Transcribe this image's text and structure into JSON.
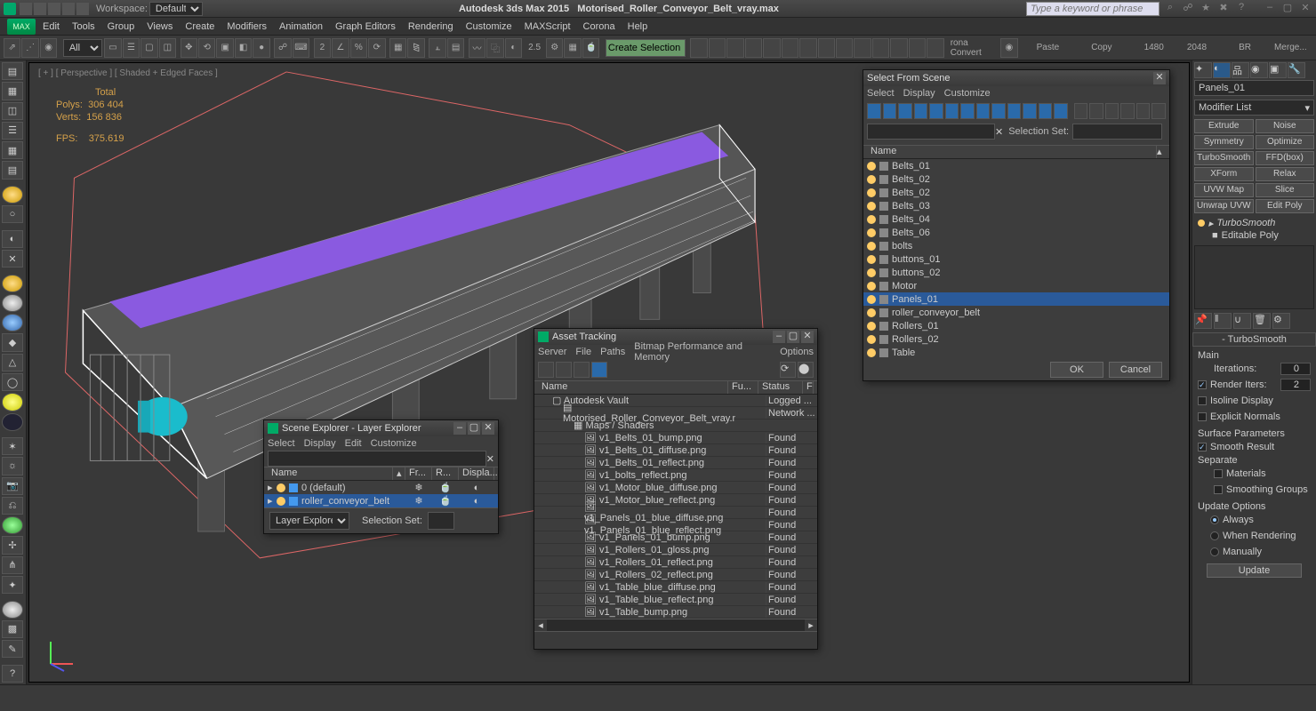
{
  "titlebar": {
    "workspace_label": "Workspace:",
    "workspace_value": "Default",
    "app": "Autodesk 3ds Max  2015",
    "file": "Motorised_Roller_Conveyor_Belt_vray.max",
    "search_placeholder": "Type a keyword or phrase"
  },
  "menu": [
    "Edit",
    "Tools",
    "Group",
    "Views",
    "Create",
    "Modifiers",
    "Animation",
    "Graph Editors",
    "Rendering",
    "Customize",
    "MAXScript",
    "Corona",
    "Help"
  ],
  "toolbar": {
    "filter_all": "All",
    "angle_snap": "2.5",
    "sel_filter": "Create Selection Se",
    "corona_convert": "rona Convert",
    "cmd_paste": "Paste",
    "cmd_copy": "Copy",
    "num1": "1480",
    "num2": "2048",
    "br": "BR",
    "merge": "Merge..."
  },
  "viewport": {
    "label": "[ + ] [ Perspective ] [ Shaded + Edged Faces ]",
    "stats": {
      "total": "Total",
      "polys_l": "Polys:",
      "polys": "306 404",
      "verts_l": "Verts:",
      "verts": "156 836",
      "fps_l": "FPS:",
      "fps": "375.619"
    }
  },
  "right": {
    "object_name": "Panels_01",
    "modifier_list": "Modifier List",
    "mod_buttons": [
      "Extrude",
      "Noise",
      "Symmetry",
      "Optimize",
      "TurboSmooth",
      "FFD(box)",
      "XForm",
      "Relax",
      "UVW Map",
      "Slice",
      "Unwrap UVW",
      "Edit Poly"
    ],
    "stack": [
      "TurboSmooth",
      "Editable Poly"
    ],
    "rollout_title": "TurboSmooth",
    "main": "Main",
    "iterations_l": "Iterations:",
    "iterations": "0",
    "render_iters_l": "Render Iters:",
    "render_iters": "2",
    "isoline": "Isoline Display",
    "explicit": "Explicit Normals",
    "surf_params": "Surface Parameters",
    "smooth_result": "Smooth Result",
    "separate": "Separate",
    "materials": "Materials",
    "smoothing_groups": "Smoothing Groups",
    "update_options": "Update Options",
    "always": "Always",
    "when_rendering": "When Rendering",
    "manually": "Manually",
    "update_btn": "Update"
  },
  "select_scene": {
    "title": "Select From Scene",
    "menu": [
      "Select",
      "Display",
      "Customize"
    ],
    "name_hdr": "Name",
    "sel_set": "Selection Set:",
    "items": [
      {
        "n": "Belts_01"
      },
      {
        "n": "Belts_02"
      },
      {
        "n": "Belts_02"
      },
      {
        "n": "Belts_03"
      },
      {
        "n": "Belts_04"
      },
      {
        "n": "Belts_06"
      },
      {
        "n": "bolts"
      },
      {
        "n": "buttons_01"
      },
      {
        "n": "buttons_02"
      },
      {
        "n": "Motor"
      },
      {
        "n": "Panels_01",
        "sel": true
      },
      {
        "n": "roller_conveyor_belt",
        "icon": "bone"
      },
      {
        "n": "Rollers_01"
      },
      {
        "n": "Rollers_02"
      },
      {
        "n": "Table"
      }
    ],
    "ok": "OK",
    "cancel": "Cancel"
  },
  "scene_explorer": {
    "title": "Scene Explorer - Layer Explorer",
    "menu": [
      "Select",
      "Display",
      "Edit",
      "Customize"
    ],
    "cols": [
      "Name",
      "Fr...",
      "R...",
      "Displa..."
    ],
    "rows": [
      {
        "n": "0 (default)"
      },
      {
        "n": "roller_conveyor_belt",
        "sel": true
      }
    ],
    "footer_combo": "Layer Explorer",
    "sel_set": "Selection Set:"
  },
  "asset_tracking": {
    "title": "Asset Tracking",
    "menu": [
      "Server",
      "File",
      "Paths",
      "Bitmap Performance and Memory",
      "Options"
    ],
    "cols": [
      "Name",
      "Fu...",
      "Status",
      "F"
    ],
    "tree": [
      {
        "n": "Autodesk Vault",
        "status": "Logged ...",
        "indent": 1,
        "icon": "box"
      },
      {
        "n": "Motorised_Roller_Conveyor_Belt_vray.max",
        "status": "Network ...",
        "indent": 2,
        "icon": "doc"
      },
      {
        "n": "Maps / Shaders",
        "status": "",
        "indent": 3,
        "icon": "folder"
      },
      {
        "n": "v1_Belts_01_bump.png",
        "status": "Found",
        "indent": 4,
        "icon": "map"
      },
      {
        "n": "v1_Belts_01_diffuse.png",
        "status": "Found",
        "indent": 4,
        "icon": "map"
      },
      {
        "n": "v1_Belts_01_reflect.png",
        "status": "Found",
        "indent": 4,
        "icon": "map"
      },
      {
        "n": "v1_bolts_reflect.png",
        "status": "Found",
        "indent": 4,
        "icon": "map"
      },
      {
        "n": "v1_Motor_blue_diffuse.png",
        "status": "Found",
        "indent": 4,
        "icon": "map"
      },
      {
        "n": "v1_Motor_blue_reflect.png",
        "status": "Found",
        "indent": 4,
        "icon": "map"
      },
      {
        "n": "v1_Panels_01_blue_diffuse.png",
        "status": "Found",
        "indent": 4,
        "icon": "map"
      },
      {
        "n": "v1_Panels_01_blue_reflect.png",
        "status": "Found",
        "indent": 4,
        "icon": "map"
      },
      {
        "n": "v1_Panels_01_bump.png",
        "status": "Found",
        "indent": 4,
        "icon": "map"
      },
      {
        "n": "v1_Rollers_01_gloss.png",
        "status": "Found",
        "indent": 4,
        "icon": "map"
      },
      {
        "n": "v1_Rollers_01_reflect.png",
        "status": "Found",
        "indent": 4,
        "icon": "map"
      },
      {
        "n": "v1_Rollers_02_reflect.png",
        "status": "Found",
        "indent": 4,
        "icon": "map"
      },
      {
        "n": "v1_Table_blue_diffuse.png",
        "status": "Found",
        "indent": 4,
        "icon": "map"
      },
      {
        "n": "v1_Table_blue_reflect.png",
        "status": "Found",
        "indent": 4,
        "icon": "map"
      },
      {
        "n": "v1_Table_bump.png",
        "status": "Found",
        "indent": 4,
        "icon": "map"
      }
    ]
  }
}
